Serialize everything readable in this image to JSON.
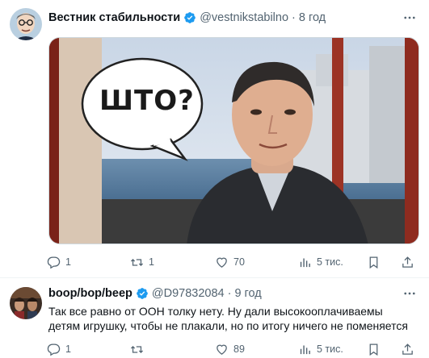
{
  "tweets": [
    {
      "author_name": "Вестник стабильности",
      "handle": "@vestnikstabilno",
      "separator": "·",
      "time": "8 год",
      "media": {
        "bubble_text": "ШТО?"
      },
      "stats": {
        "replies": "1",
        "retweets": "1",
        "likes": "70",
        "views": "5 тис."
      }
    },
    {
      "author_name": "boop/bop/beep",
      "handle": "@D97832084",
      "separator": "·",
      "time": "9 год",
      "text": "Так все равно от ООН толку нету. Ну дали высокооплачиваемы детям игрушку, чтобы не плакали, но по итогу ничего не поменяется",
      "stats": {
        "replies": "1",
        "retweets": "",
        "likes": "89",
        "views": "5 тис."
      }
    }
  ],
  "colors": {
    "verified": "#1d9bf0",
    "muted": "#536471",
    "text": "#0f1419",
    "divider": "#eff3f4"
  },
  "icons": [
    "verified-badge-icon",
    "more-icon",
    "reply-icon",
    "retweet-icon",
    "like-icon",
    "views-icon",
    "bookmark-icon",
    "share-icon"
  ]
}
